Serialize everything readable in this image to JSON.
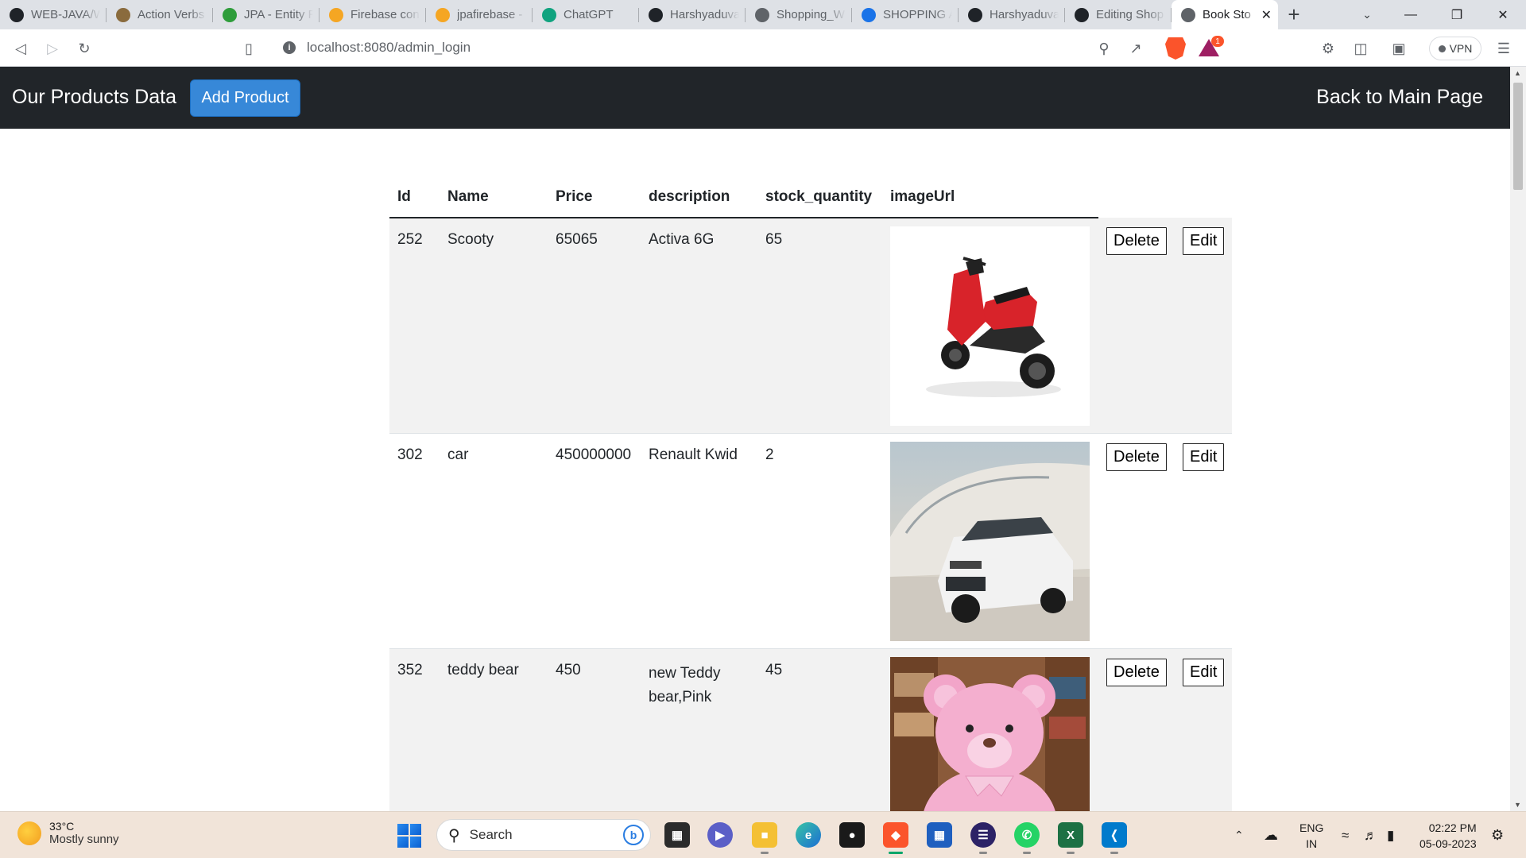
{
  "browser": {
    "tabs": [
      {
        "title": "WEB-JAVA/W",
        "icon": "github-icon",
        "color": "#1f2328"
      },
      {
        "title": "Action Verbs",
        "icon": "action-verbs-icon",
        "color": "#8a6b3d"
      },
      {
        "title": "JPA - Entity R",
        "icon": "jpa-icon",
        "color": "#2e9d3b"
      },
      {
        "title": "Firebase con",
        "icon": "firebase-icon",
        "color": "#f5a623"
      },
      {
        "title": "jpafirebase -",
        "icon": "firebase-icon",
        "color": "#f5a623"
      },
      {
        "title": "ChatGPT",
        "icon": "chatgpt-icon",
        "color": "#10a37f"
      },
      {
        "title": "Harshyaduva",
        "icon": "github-icon",
        "color": "#1f2328"
      },
      {
        "title": "Shopping_W",
        "icon": "globe-icon",
        "color": "#5f6368"
      },
      {
        "title": "SHOPPING A",
        "icon": "google-drive-icon",
        "color": "#1a73e8"
      },
      {
        "title": "Harshyaduva",
        "icon": "github-icon",
        "color": "#1f2328"
      },
      {
        "title": "Editing Shop",
        "icon": "github-icon",
        "color": "#1f2328"
      },
      {
        "title": "Book Sto",
        "icon": "globe-icon",
        "color": "#5f6368",
        "active": true
      }
    ],
    "url": "localhost:8080/admin_login",
    "vpn_label": "VPN",
    "alert_count": "1"
  },
  "page": {
    "brand": "Our Products Data",
    "add_button": "Add Product",
    "back_link": "Back to Main Page",
    "columns": [
      "Id",
      "Name",
      "Price",
      "description",
      "stock_quantity",
      "imageUrl"
    ],
    "rows": [
      {
        "id": "252",
        "name": "Scooty",
        "price": "65065",
        "description": "Activa 6G",
        "stock": "65",
        "image": "red-scooter-image",
        "delete": "Delete",
        "edit": "Edit"
      },
      {
        "id": "302",
        "name": "car",
        "price": "450000000",
        "description": "Renault Kwid",
        "stock": "2",
        "image": "white-renault-kwid-image",
        "delete": "Delete",
        "edit": "Edit"
      },
      {
        "id": "352",
        "name": "teddy bear",
        "price": "450",
        "description": "new Teddy bear,Pink",
        "stock": "45",
        "image": "pink-teddy-bear-image",
        "delete": "Delete",
        "edit": "Edit"
      }
    ]
  },
  "taskbar": {
    "weather_temp": "33°C",
    "weather_desc": "Mostly sunny",
    "search_label": "Search",
    "lang_top": "ENG",
    "lang_bottom": "IN",
    "time": "02:22 PM",
    "date": "05-09-2023"
  }
}
